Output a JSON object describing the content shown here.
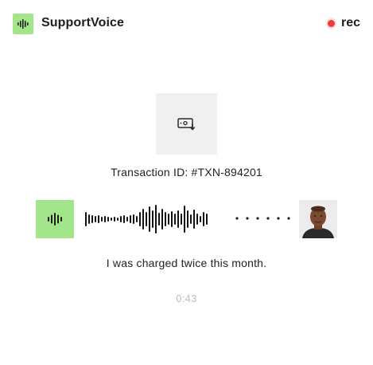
{
  "header": {
    "app_title": "SupportVoice",
    "logo_icon": "waveform-icon",
    "recording_label": "rec",
    "recording_color": "#ef3b3b"
  },
  "call": {
    "transaction_icon": "payment-card-download-icon",
    "transaction_text": "Transaction ID: #TXN-894201",
    "agent_icon": "waveform-icon",
    "customer_avatar": "customer-photo",
    "transcript": "I was charged twice this month.",
    "elapsed": "0:43"
  },
  "colors": {
    "accent_green": "#a3e58a",
    "tile_gray": "#f0f0f0",
    "text_dark": "#1d1d1d",
    "timer_gray": "#bdbdbd"
  }
}
